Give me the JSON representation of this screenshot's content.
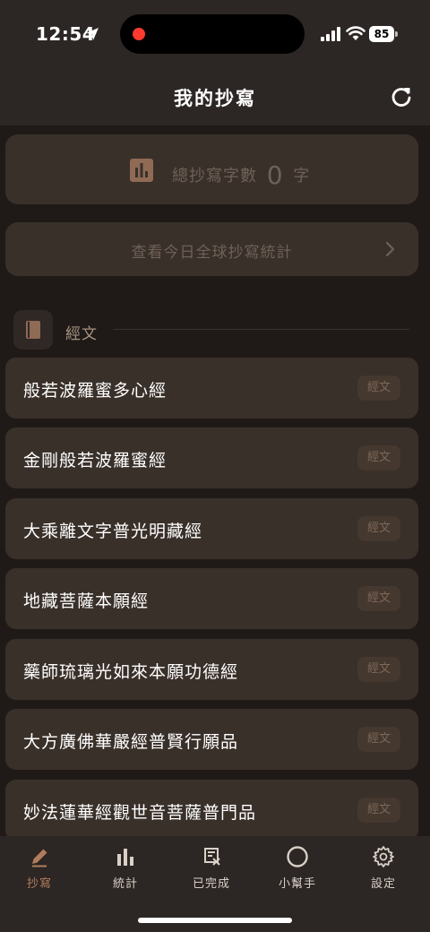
{
  "status": {
    "time": "12:54",
    "battery": "85"
  },
  "header": {
    "title": "我的抄寫"
  },
  "total": {
    "label": "總抄寫字數",
    "count": "0",
    "unit": "字"
  },
  "stats_link": {
    "label": "查看今日全球抄寫統計"
  },
  "section": {
    "title": "經文"
  },
  "sutras": [
    {
      "name": "般若波羅蜜多心經",
      "tag": "經文"
    },
    {
      "name": "金剛般若波羅蜜經",
      "tag": "經文"
    },
    {
      "name": "大乘離文字普光明藏經",
      "tag": "經文"
    },
    {
      "name": "地藏菩薩本願經",
      "tag": "經文"
    },
    {
      "name": "藥師琉璃光如來本願功德經",
      "tag": "經文"
    },
    {
      "name": "大方廣佛華嚴經普賢行願品",
      "tag": "經文"
    },
    {
      "name": "妙法蓮華經觀世音菩薩普門品",
      "tag": "經文"
    }
  ],
  "tabs": [
    {
      "label": "抄寫",
      "icon": "pencil-icon",
      "active": true
    },
    {
      "label": "統計",
      "icon": "bar-chart-icon",
      "active": false
    },
    {
      "label": "已完成",
      "icon": "completed-scroll-icon",
      "active": false
    },
    {
      "label": "小幫手",
      "icon": "circle-icon",
      "active": false
    },
    {
      "label": "設定",
      "icon": "gear-icon",
      "active": false
    }
  ],
  "colors": {
    "accent": "#b17d5c",
    "background": "#1f1a18",
    "card": "#3a302a",
    "bar": "#2c2624"
  }
}
